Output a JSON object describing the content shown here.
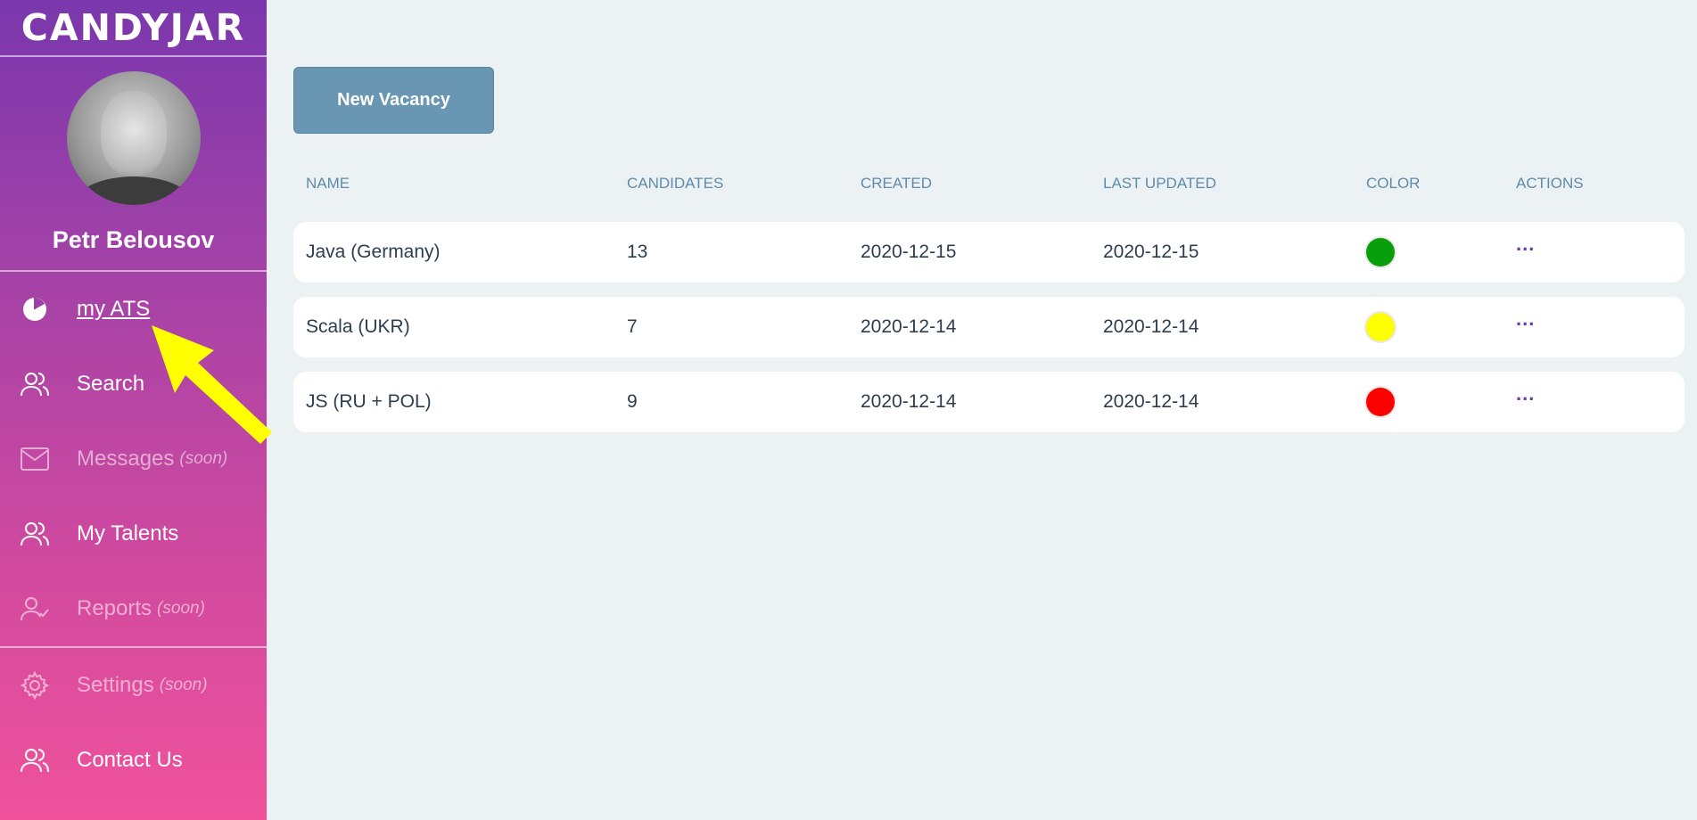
{
  "app": {
    "logo": "CANDYJAR"
  },
  "user": {
    "name": "Petr Belousov"
  },
  "sidebar": {
    "items": [
      {
        "label": "my ATS",
        "soon": "",
        "icon": "pie-chart-icon"
      },
      {
        "label": "Search",
        "soon": "",
        "icon": "users-icon"
      },
      {
        "label": "Messages",
        "soon": "(soon)",
        "icon": "mail-icon"
      },
      {
        "label": "My Talents",
        "soon": "",
        "icon": "users-icon"
      },
      {
        "label": "Reports",
        "soon": "(soon)",
        "icon": "user-check-icon"
      },
      {
        "label": "Settings",
        "soon": "(soon)",
        "icon": "gear-icon"
      },
      {
        "label": "Contact Us",
        "soon": "",
        "icon": "users-icon"
      }
    ]
  },
  "main": {
    "new_button": "New Vacancy",
    "columns": {
      "name": "NAME",
      "candidates": "CANDIDATES",
      "created": "CREATED",
      "updated": "LAST UPDATED",
      "color": "COLOR",
      "actions": "ACTIONS"
    },
    "rows": [
      {
        "name": "Java (Germany)",
        "candidates": "13",
        "created": "2020-12-15",
        "updated": "2020-12-15",
        "color": "#089e0c",
        "actions": "..."
      },
      {
        "name": "Scala (UKR)",
        "candidates": "7",
        "created": "2020-12-14",
        "updated": "2020-12-14",
        "color": "#ffff00",
        "actions": "..."
      },
      {
        "name": "JS (RU + POL)",
        "candidates": "9",
        "created": "2020-12-14",
        "updated": "2020-12-14",
        "color": "#ff0000",
        "actions": "..."
      }
    ]
  },
  "colors": {
    "accent": "#6996b3",
    "header_text": "#5f8bab",
    "annotation_arrow": "#ffff00"
  }
}
